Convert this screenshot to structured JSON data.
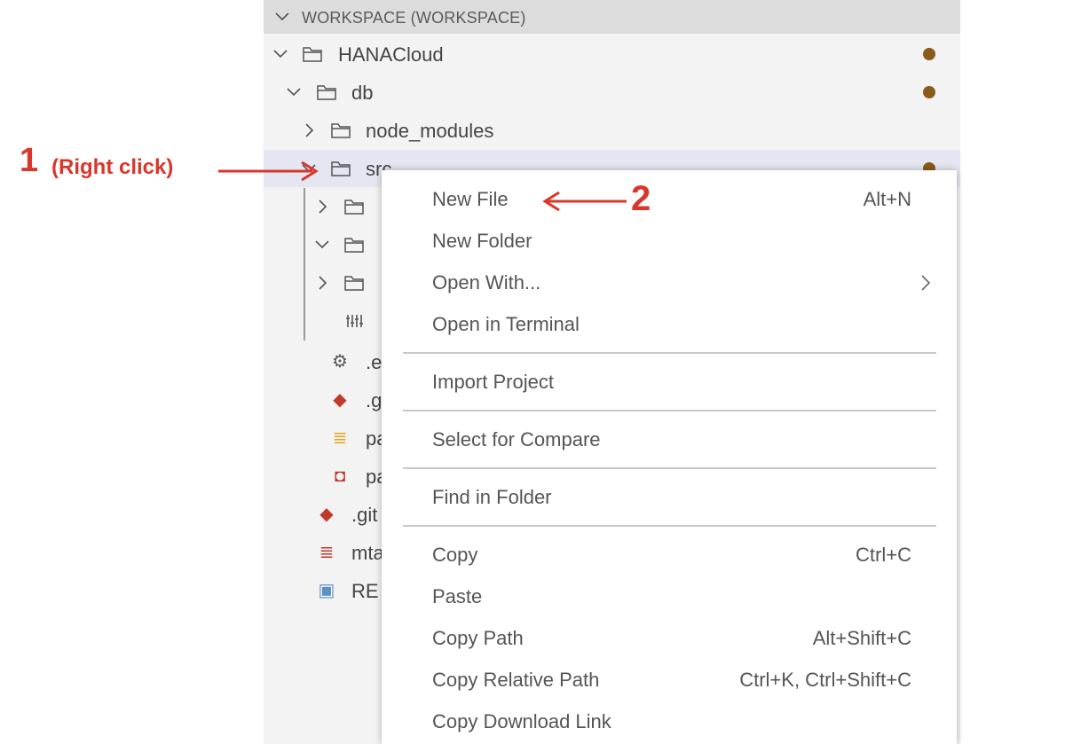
{
  "explorer": {
    "section_title": "WORKSPACE (WORKSPACE)",
    "tree": {
      "hanacloud": "HANACloud",
      "db": "db",
      "node_modules": "node_modules",
      "src": "src",
      "row_e": ".e",
      "row_g": ".g",
      "row_pa1": "pa",
      "row_pa2": "pa",
      "row_git": ".git",
      "row_mta": "mta",
      "row_re": "RE"
    },
    "modified_indicator_color": "#8a5a1c"
  },
  "context_menu": {
    "items": [
      {
        "label": "New File",
        "shortcut": "Alt+N"
      },
      {
        "label": "New Folder",
        "shortcut": ""
      },
      {
        "label": "Open With...",
        "shortcut": ""
      },
      {
        "label": "Open in Terminal",
        "shortcut": ""
      },
      {
        "label": "Import Project",
        "shortcut": ""
      },
      {
        "label": "Select for Compare",
        "shortcut": ""
      },
      {
        "label": "Find in Folder",
        "shortcut": ""
      },
      {
        "label": "Copy",
        "shortcut": "Ctrl+C"
      },
      {
        "label": "Paste",
        "shortcut": ""
      },
      {
        "label": "Copy Path",
        "shortcut": "Alt+Shift+C"
      },
      {
        "label": "Copy Relative Path",
        "shortcut": "Ctrl+K, Ctrl+Shift+C"
      },
      {
        "label": "Copy Download Link",
        "shortcut": ""
      }
    ]
  },
  "annotations": {
    "step1_number": "1",
    "step1_text": "(Right click)",
    "step2_number": "2",
    "color": "#d9372b"
  }
}
